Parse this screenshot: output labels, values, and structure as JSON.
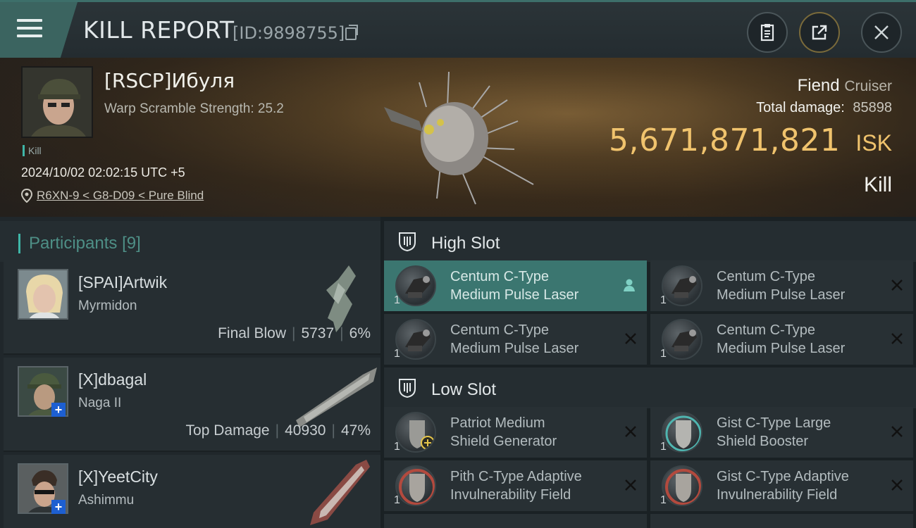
{
  "header": {
    "title": "KILL REPORT",
    "report_id": "[ID:9898755]"
  },
  "victim": {
    "name": "[RSCP]Ибуля",
    "warp_scramble": "Warp Scramble Strength: 25.2",
    "kill_tag": "Kill",
    "datetime": "2024/10/02 02:02:15 UTC +5",
    "location": "R6XN-9 < G8-D09 < Pure Blind",
    "ship_name": "Fiend",
    "ship_class": "Cruiser",
    "total_damage_label": "Total damage:",
    "total_damage": "85898",
    "isk_value": "5,671,871,821",
    "isk_unit": "ISK",
    "result": "Kill"
  },
  "participants": {
    "label": "Participants",
    "count": "[9]",
    "rows": [
      {
        "name": "[SPAI]Artwik",
        "ship": "Myrmidon",
        "role": "Final Blow",
        "damage": "5737",
        "percent": "6%"
      },
      {
        "name": "[X]dbagal",
        "ship": "Naga II",
        "role": "Top Damage",
        "damage": "40930",
        "percent": "47%"
      },
      {
        "name": "[X]YeetCity",
        "ship": "Ashimmu",
        "role": "",
        "damage": "",
        "percent": ""
      }
    ]
  },
  "fitting": {
    "high_slot_label": "High Slot",
    "low_slot_label": "Low Slot",
    "high": [
      {
        "line1": "Centum C-Type",
        "line2": "Medium Pulse Laser",
        "qty": "1"
      },
      {
        "line1": "Centum C-Type",
        "line2": "Medium Pulse Laser",
        "qty": "1"
      },
      {
        "line1": "Centum C-Type",
        "line2": "Medium Pulse Laser",
        "qty": "1"
      },
      {
        "line1": "Centum C-Type",
        "line2": "Medium Pulse Laser",
        "qty": "1"
      }
    ],
    "low": [
      {
        "line1": "Patriot Medium",
        "line2": "Shield Generator",
        "qty": "1"
      },
      {
        "line1": "Gist C-Type Large",
        "line2": "Shield Booster",
        "qty": "1"
      },
      {
        "line1": "Pith C-Type Adaptive",
        "line2": "Invulnerability Field",
        "qty": "1"
      },
      {
        "line1": "Gist C-Type Adaptive",
        "line2": "Invulnerability Field",
        "qty": "1"
      }
    ]
  },
  "colors": {
    "accent_teal": "#3fb6a8",
    "isk_gold": "#f0c36d",
    "selected_module": "#3b7670"
  },
  "icons": [
    "menu-icon",
    "copy-icon",
    "clipboard-icon",
    "share-icon",
    "close-icon",
    "location-pin-icon",
    "slot-icon",
    "person-icon",
    "destroyed-x-icon",
    "plus-icon"
  ]
}
